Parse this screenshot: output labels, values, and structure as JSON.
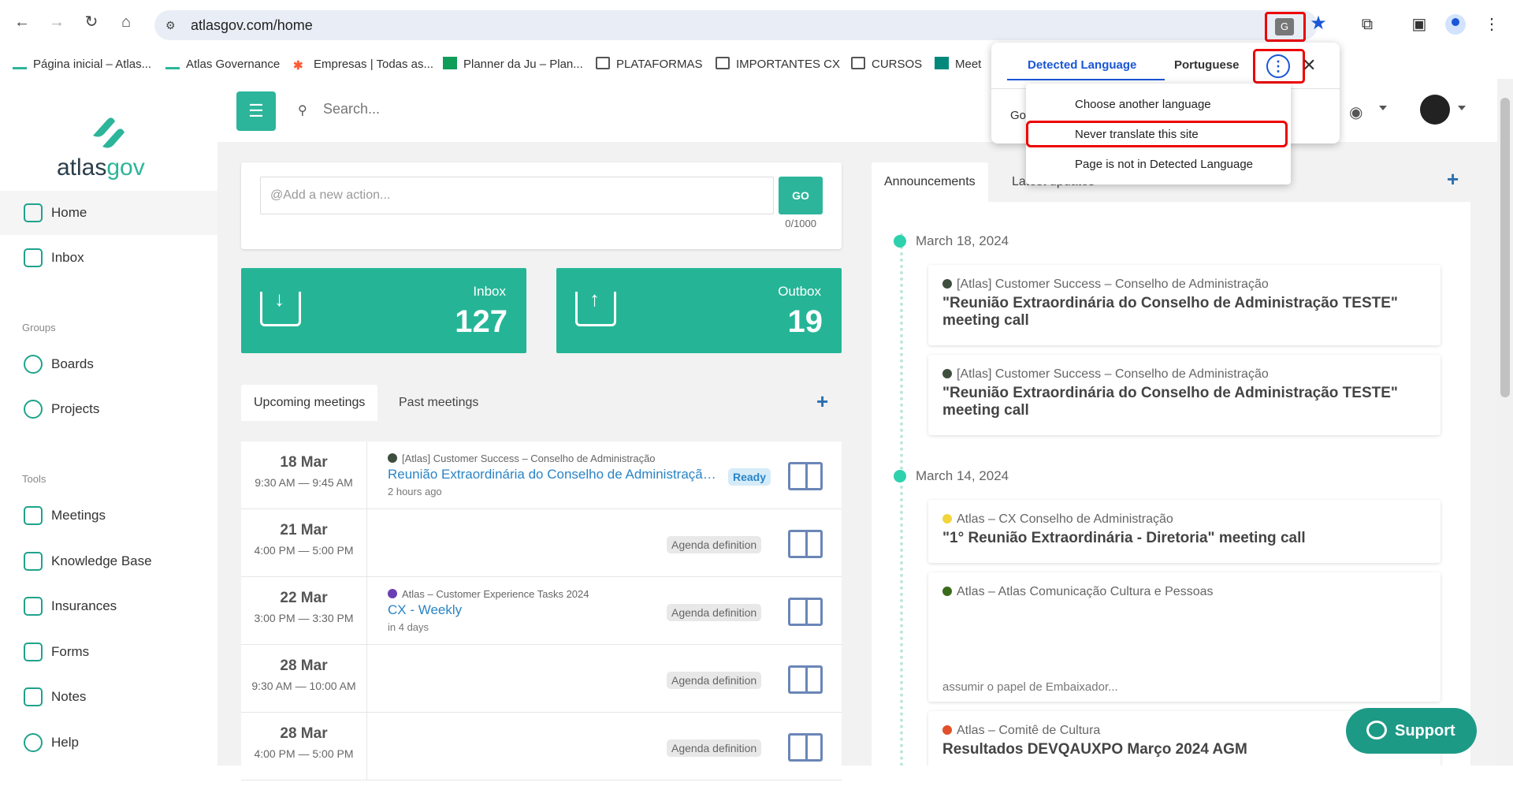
{
  "browser": {
    "url": "atlasgov.com/home",
    "bookmarks": [
      {
        "label": "Página inicial – Atlas..."
      },
      {
        "label": "Atlas Governance"
      },
      {
        "label": "Empresas | Todas as..."
      },
      {
        "label": "Planner da Ju – Plan..."
      },
      {
        "label": "PLATAFORMAS"
      },
      {
        "label": "IMPORTANTES CX"
      },
      {
        "label": "CURSOS"
      },
      {
        "label": "Meet"
      }
    ]
  },
  "translate_popup": {
    "tab_detected": "Detected Language",
    "tab_portuguese": "Portuguese",
    "go_fragment": "Go",
    "menu": {
      "choose": "Choose another language",
      "never": "Never translate this site",
      "not_detected": "Page is not in Detected Language"
    }
  },
  "sidebar": {
    "logo_text_1": "atlas",
    "logo_text_2": "gov",
    "items": [
      {
        "label": "Home"
      },
      {
        "label": "Inbox"
      },
      {
        "label": "Boards"
      },
      {
        "label": "Projects"
      },
      {
        "label": "Meetings"
      },
      {
        "label": "Knowledge Base"
      },
      {
        "label": "Insurances"
      },
      {
        "label": "Forms"
      },
      {
        "label": "Notes"
      },
      {
        "label": "Help"
      }
    ],
    "heading_groups": "Groups",
    "heading_tools": "Tools"
  },
  "topbar": {
    "search_placeholder": "Search..."
  },
  "action": {
    "placeholder": "@Add a new action...",
    "go_label": "GO",
    "counter": "0/1000"
  },
  "stats": {
    "inbox_label": "Inbox",
    "inbox_count": "127",
    "outbox_label": "Outbox",
    "outbox_count": "19"
  },
  "meetings": {
    "tab_upcoming": "Upcoming meetings",
    "tab_past": "Past meetings",
    "rows": [
      {
        "day": "18 Mar",
        "time": "9:30 AM — 9:45 AM",
        "group": "[Atlas] Customer Success – Conselho de Administração",
        "title": "Reunião Extraordinária do Conselho de Administração TESTE",
        "ago": "2 hours ago",
        "status": "Ready"
      },
      {
        "day": "21 Mar",
        "time": "4:00 PM — 5:00 PM",
        "group": "",
        "title": "",
        "ago": "",
        "status": "Agenda definition"
      },
      {
        "day": "22 Mar",
        "time": "3:00 PM — 3:30 PM",
        "group": "Atlas – Customer Experience Tasks 2024",
        "title": "CX - Weekly",
        "ago": "in 4 days",
        "status": "Agenda definition"
      },
      {
        "day": "28 Mar",
        "time": "9:30 AM — 10:00 AM",
        "group": "",
        "title": "",
        "ago": "",
        "status": "Agenda definition"
      },
      {
        "day": "28 Mar",
        "time": "4:00 PM — 5:00 PM",
        "group": "",
        "title": "",
        "ago": "",
        "status": "Agenda definition"
      }
    ]
  },
  "announcements": {
    "tab_announcements": "Announcements",
    "tab_latest": "Latest updates",
    "groups": [
      {
        "date": "March 18, 2024"
      },
      {
        "date": "March 14, 2024"
      }
    ],
    "cards": [
      {
        "group": "[Atlas] Customer Success – Conselho de Administração",
        "title": "\"Reunião Extraordinária do Conselho de Administração TESTE\" meeting call",
        "snippet": ""
      },
      {
        "group": "[Atlas] Customer Success – Conselho de Administração",
        "title": "\"Reunião Extraordinária do Conselho de Administração TESTE\" meeting call",
        "snippet": ""
      },
      {
        "group": "Atlas – CX Conselho de Administração",
        "title": "\"1° Reunião Extraordinária - Diretoria\" meeting call",
        "snippet": ""
      },
      {
        "group": "Atlas – Atlas Comunicação Cultura e Pessoas",
        "title": "",
        "snippet": "assumir o papel de Embaixador..."
      },
      {
        "group": "Atlas – Comitê de Cultura",
        "title": "Resultados DEVQAUXPO Março 2024 AGM",
        "snippet": ""
      }
    ]
  },
  "support": {
    "label": "Support"
  },
  "colors": {
    "brand": "#2cb59a",
    "link": "#2a84c6",
    "highlight": "#e00000",
    "chrome_blue": "#1a56d6"
  }
}
